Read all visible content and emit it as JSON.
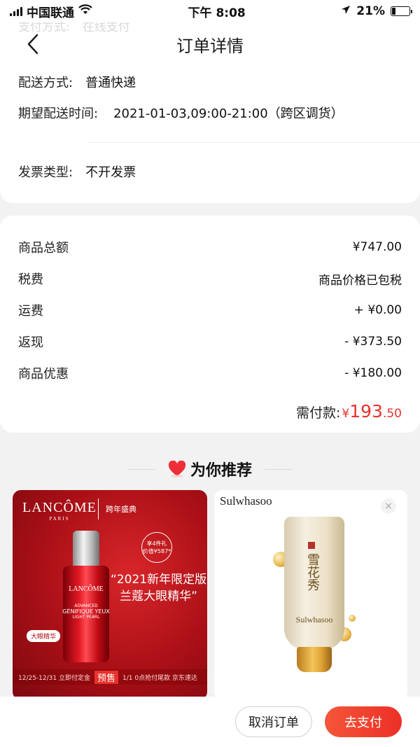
{
  "status_bar": {
    "carrier": "中国联通",
    "time": "下午 8:08",
    "battery_percent": "21%",
    "battery_level": 0.21
  },
  "header": {
    "title": "订单详情",
    "ghost_label": "支付方式:",
    "ghost_value": "在线支付"
  },
  "delivery": {
    "method_label": "配送方式:",
    "method_value": "普通快递",
    "expected_label": "期望配送时间:",
    "expected_value": "2021-01-03,09:00-21:00（跨区调货）",
    "invoice_label": "发票类型:",
    "invoice_value": "不开发票"
  },
  "price": {
    "rows": [
      {
        "label": "商品总额",
        "value": "¥747.00"
      },
      {
        "label": "税费",
        "value": "商品价格已包税"
      },
      {
        "label": "运费",
        "value": "+ ¥0.00"
      },
      {
        "label": "返现",
        "value": "- ¥373.50"
      },
      {
        "label": "商品优惠",
        "value": "- ¥180.00"
      }
    ],
    "total_label": "需付款:",
    "total_currency": "¥",
    "total_int": "193",
    "total_dec": ".50"
  },
  "recommend": {
    "title": "为你推荐",
    "products": [
      {
        "brand": "LANCÔME",
        "brand_sub": "PARIS",
        "event": "跨年盛典",
        "bottle_brand": "LANCÔME",
        "bottle_line1": "ADVANCED",
        "bottle_line2": "GÉNIFIQUE YEUX",
        "bottle_line3": "LIGHT PEARL",
        "gift_line1": "享4件礼",
        "gift_line2": "价值¥587*",
        "promo_line1": "“2021新年限定版",
        "promo_line2": "兰蔻大眼精华”",
        "tag": "大眼精华",
        "presale_dates": "12/25-12/31 立即付定金",
        "presale_label": "预售",
        "presale_tail": "1/1 0点抢付尾款 京东速达"
      },
      {
        "brand": "Sulwhasoo",
        "tube_chars": "雪花秀",
        "tube_brand": "Sulwhasoo",
        "close": "×"
      }
    ]
  },
  "actions": {
    "cancel_label": "取消订单",
    "pay_label": "去支付"
  },
  "colors": {
    "accent": "#e8322c",
    "card_bg": "#ffffff",
    "page_bg": "#f2f2f2"
  }
}
